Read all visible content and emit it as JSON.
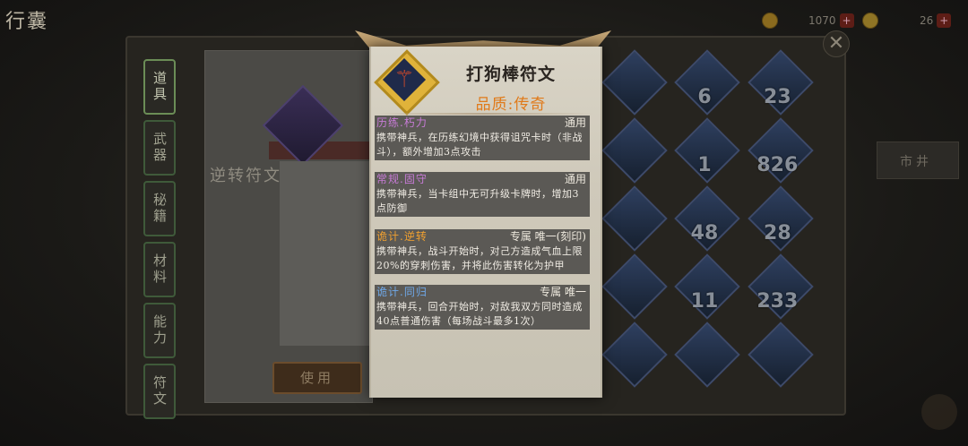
{
  "header": {
    "title": "行囊",
    "subtitle": "",
    "resources": [
      {
        "icon": "gold-coin-icon",
        "value": "1070"
      },
      {
        "icon": "ingot-icon",
        "value": "26"
      }
    ]
  },
  "side_tabs": [
    {
      "label": "道具",
      "active": true
    },
    {
      "label": "武器",
      "active": false
    },
    {
      "label": "秘籍",
      "active": false
    },
    {
      "label": "材料",
      "active": false
    },
    {
      "label": "能力",
      "active": false
    },
    {
      "label": "符文",
      "active": false
    }
  ],
  "detail": {
    "name": "逆转符文",
    "use_label": "使用"
  },
  "grid_counts": [
    "",
    "6",
    "23",
    "",
    "1",
    "826",
    "",
    "48",
    "28",
    "",
    "11",
    "233",
    "",
    "",
    ""
  ],
  "right_flag": "市井",
  "popup": {
    "name": "打狗棒符文",
    "quality": "品质:传奇",
    "effects": [
      {
        "title": "历练.朽力",
        "title_color": "#c77bd6",
        "tag": "通用",
        "desc": "携带神兵，在历练幻境中获得诅咒卡时（非战斗），额外增加3点攻击"
      },
      {
        "title": "常规.固守",
        "title_color": "#c77bd6",
        "tag": "通用",
        "desc": "携带神兵，当卡组中无可升级卡牌时，增加3点防御"
      },
      {
        "title": "诡计.逆转",
        "title_color": "#f0a030",
        "tag": "专属 唯一(刻印)",
        "desc": "携带神兵，战斗开始时，对己方造成气血上限20%的穿刺伤害，并将此伤害转化为护甲"
      },
      {
        "title": "诡计.同归",
        "title_color": "#6fa8e8",
        "tag": "专属 唯一",
        "desc": "携带神兵，回合开始时，对敌我双方同时造成40点普通伤害（每场战斗最多1次）"
      }
    ]
  }
}
